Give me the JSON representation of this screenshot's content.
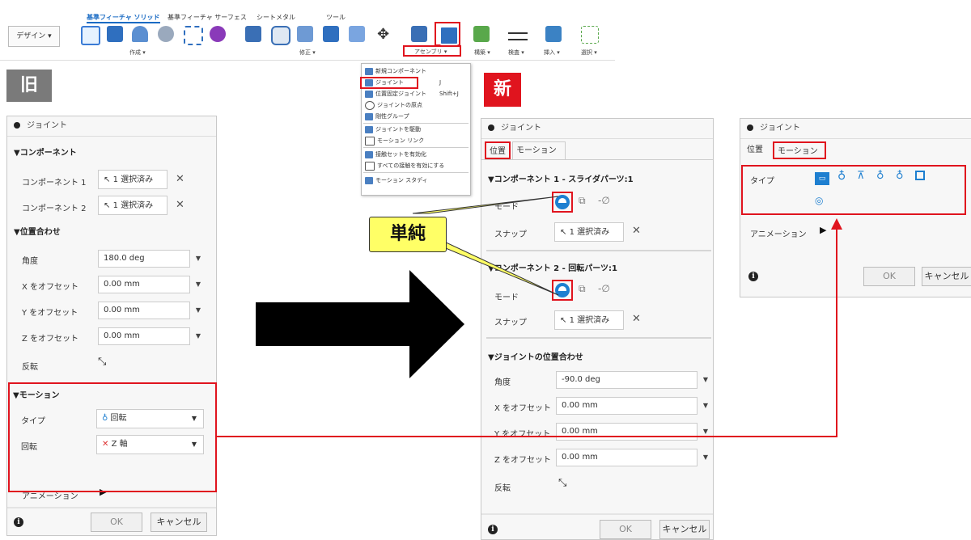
{
  "toolbar": {
    "design_button": "デザイン ▾",
    "tabs": [
      "基準フィーチャ ソリッド",
      "基準フィーチャ サーフェス",
      "シートメタル",
      "ツール"
    ],
    "groups": [
      "作成 ▾",
      "修正 ▾",
      "アセンブリ ▾",
      "構築 ▾",
      "検査 ▾",
      "挿入 ▾",
      "選択 ▾"
    ]
  },
  "menu": {
    "items": [
      {
        "label": "新規コンポーネント",
        "shortcut": ""
      },
      {
        "label": "ジョイント",
        "shortcut": "J"
      },
      {
        "label": "位置固定ジョイント",
        "shortcut": "Shift+J"
      },
      {
        "label": "ジョイントの原点",
        "shortcut": ""
      },
      {
        "label": "剛性グループ",
        "shortcut": ""
      },
      {
        "label": "ジョイントを駆動",
        "shortcut": ""
      },
      {
        "label": "モーション リンク",
        "shortcut": ""
      },
      {
        "label": "接触セットを有効化",
        "shortcut": ""
      },
      {
        "label": "すべての接触を有効にする",
        "shortcut": ""
      },
      {
        "label": "モーション スタディ",
        "shortcut": ""
      }
    ]
  },
  "labels": {
    "old": "旧",
    "new": "新",
    "callout": "単純"
  },
  "old_panel": {
    "title": "ジョイント",
    "components_header": "▼コンポーネント",
    "component1": "コンポーネント 1",
    "component2": "コンポーネント 2",
    "selected": "1 選択済み",
    "alignment_header": "▼位置合わせ",
    "angle_label": "角度",
    "angle_value": "180.0 deg",
    "offset_x_label": "X をオフセット",
    "offset_x_value": "0.00 mm",
    "offset_y_label": "Y をオフセット",
    "offset_y_value": "0.00 mm",
    "offset_z_label": "Z をオフセット",
    "offset_z_value": "0.00 mm",
    "flip_label": "反転",
    "motion_header": "▼モーション",
    "type_label": "タイプ",
    "type_value": "回転",
    "rotation_label": "回転",
    "rotation_value": "Z 軸",
    "animation_label": "アニメーション",
    "ok": "OK",
    "cancel": "キャンセル"
  },
  "new_panel": {
    "title": "ジョイント",
    "tab_position": "位置",
    "tab_motion": "モーション",
    "comp1_header": "▼コンポーネント 1 - スライダパーツ:1",
    "comp2_header": "▼コンポーネント 2 - 回転パーツ:1",
    "mode_label": "モード",
    "snap_label": "スナップ",
    "selected": "1 選択済み",
    "alignment_header": "▼ジョイントの位置合わせ",
    "angle_label": "角度",
    "angle_value": "-90.0 deg",
    "offset_x_label": "X をオフセット",
    "offset_x_value": "0.00 mm",
    "offset_y_label": "Y をオフセット",
    "offset_y_value": "0.00 mm",
    "offset_z_label": "Z をオフセット",
    "offset_z_value": "0.00 mm",
    "flip_label": "反転",
    "ok": "OK",
    "cancel": "キャンセル"
  },
  "motion_panel": {
    "title": "ジョイント",
    "tab_position": "位置",
    "tab_motion": "モーション",
    "type_label": "タイプ",
    "animation_label": "アニメーション",
    "ok": "OK",
    "cancel": "キャンセル"
  },
  "colors": {
    "accent": "#1e7fd0",
    "highlight": "#e0141e",
    "callout": "#ffff66",
    "tag_old": "#7a7a7a",
    "tag_new": "#e0141e"
  }
}
